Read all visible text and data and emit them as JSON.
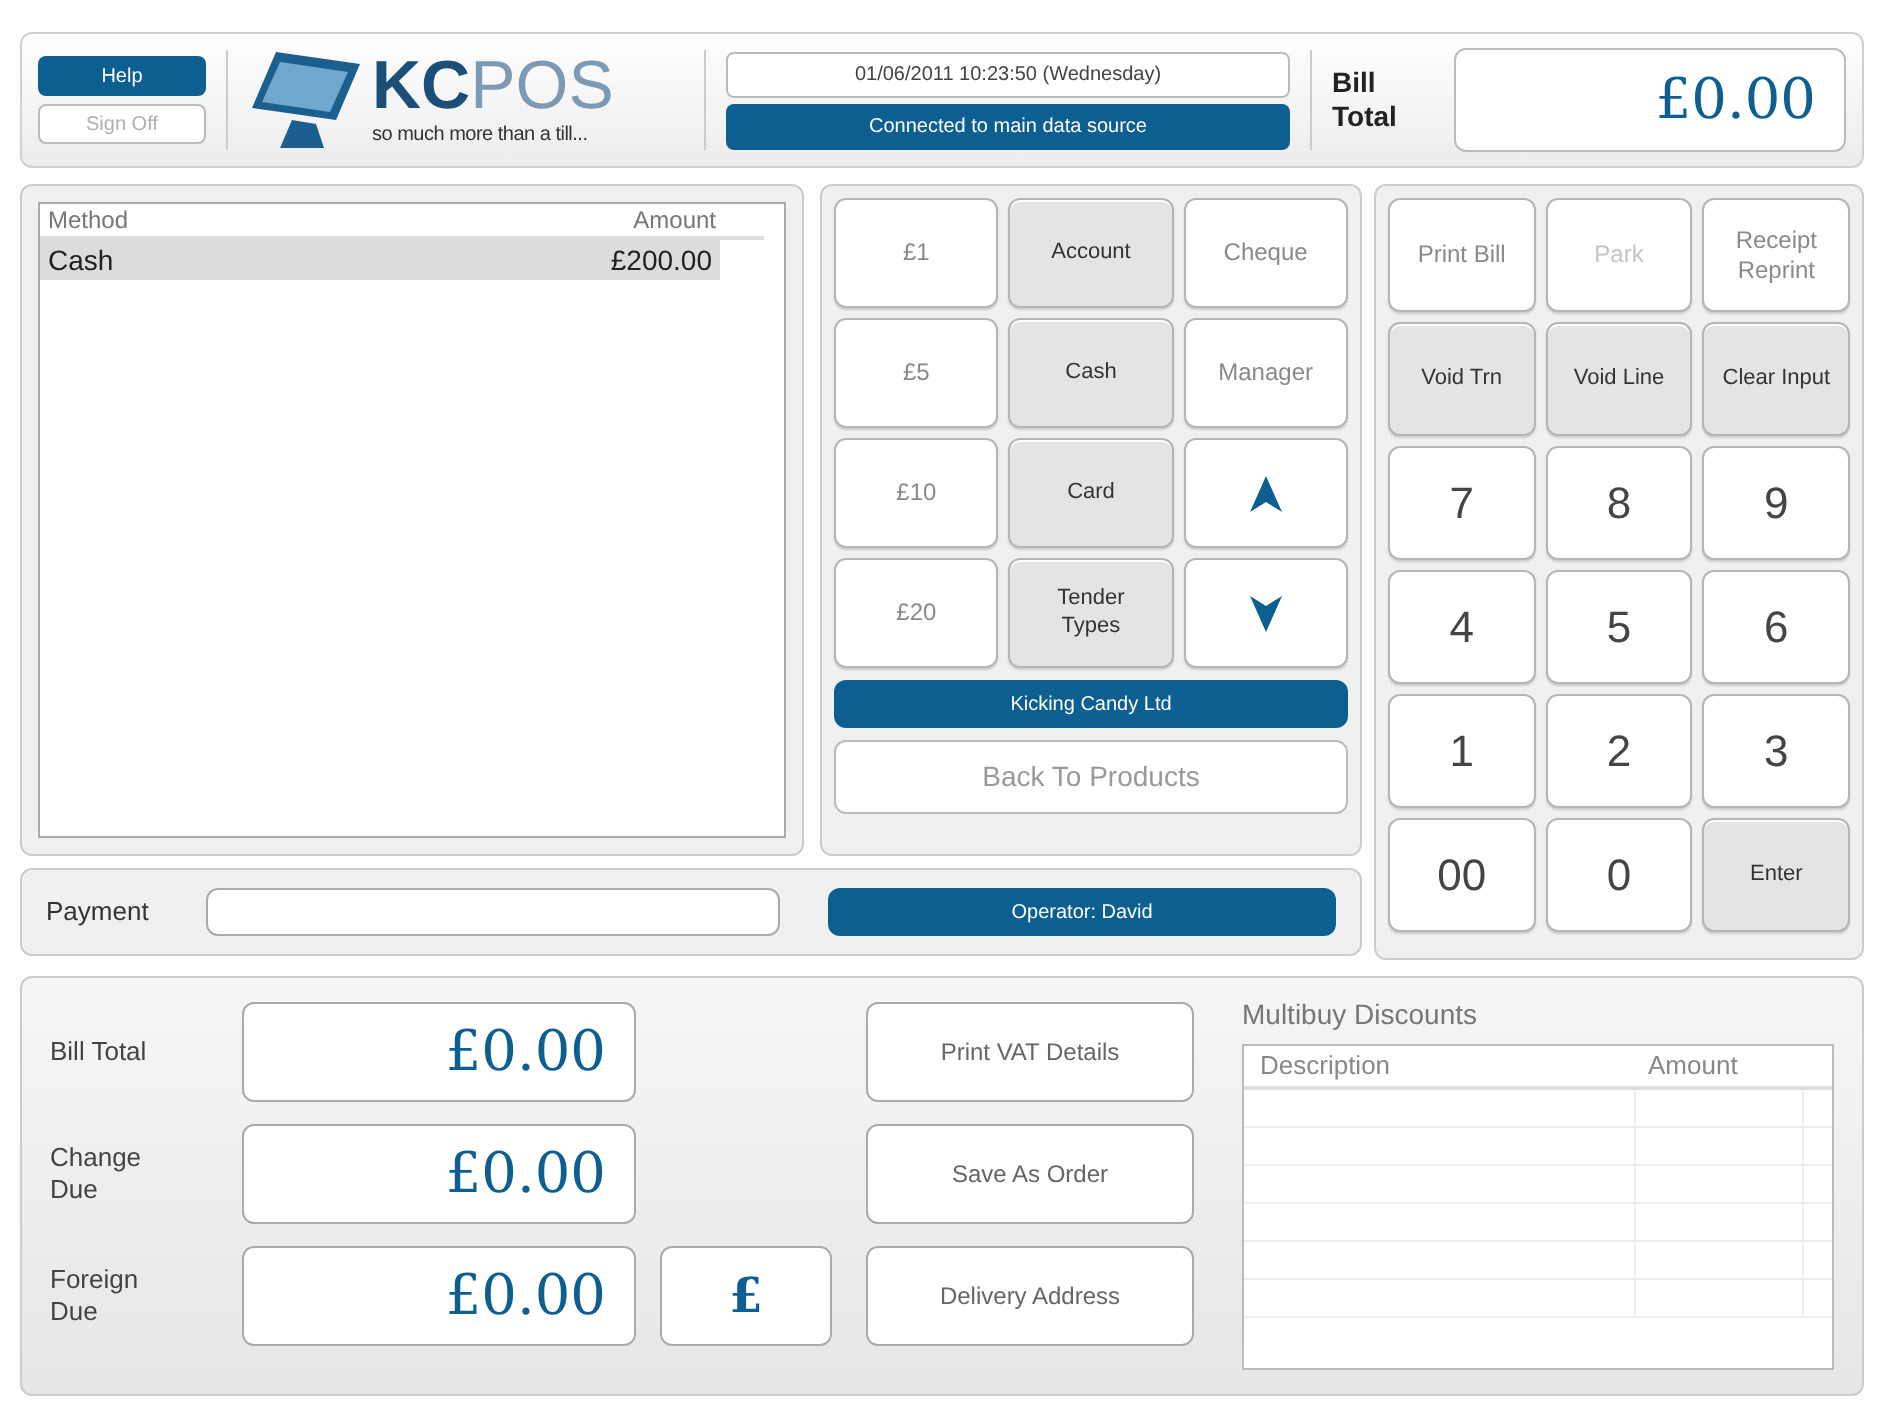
{
  "header": {
    "help": "Help",
    "sign_off": {
      "label": "Sign Off",
      "disabled": true
    },
    "logo": {
      "brand_bold": "KC",
      "brand_light": "POS",
      "tagline": "so much more than a till..."
    },
    "datetime": "01/06/2011 10:23:50  (Wednesday)",
    "connection": "Connected to main data source",
    "bill_total_label": "Bill Total",
    "bill_total": "£0.00"
  },
  "payments_table": {
    "columns": [
      "Method",
      "Amount"
    ],
    "rows": [
      {
        "method": "Cash",
        "amount": "£200.00",
        "selected": true
      }
    ]
  },
  "tender_buttons": [
    {
      "label": "£1",
      "kind": "plain"
    },
    {
      "label": "Account",
      "kind": "shaded"
    },
    {
      "label": "Cheque",
      "kind": "plain"
    },
    {
      "label": "£5",
      "kind": "plain"
    },
    {
      "label": "Cash",
      "kind": "shaded"
    },
    {
      "label": "Manager",
      "kind": "plain"
    },
    {
      "label": "£10",
      "kind": "plain"
    },
    {
      "label": "Card",
      "kind": "shaded"
    },
    {
      "kind": "up"
    },
    {
      "label": "£20",
      "kind": "plain"
    },
    {
      "label": "Tender Types",
      "kind": "shaded"
    },
    {
      "kind": "down"
    }
  ],
  "company": "Kicking Candy Ltd",
  "back_button": "Back To Products",
  "keypad_rows": [
    {
      "keys": [
        {
          "label": "Print Bill",
          "kind": "plain"
        },
        {
          "label": "Park",
          "kind": "faint"
        },
        {
          "label": "Receipt Reprint",
          "kind": "plain"
        }
      ]
    },
    {
      "keys": [
        {
          "label": "Void Trn",
          "kind": "shaded"
        },
        {
          "label": "Void Line",
          "kind": "shaded"
        },
        {
          "label": "Clear Input",
          "kind": "shaded"
        }
      ]
    },
    {
      "keys": [
        {
          "label": "7",
          "kind": "digit"
        },
        {
          "label": "8",
          "kind": "digit"
        },
        {
          "label": "9",
          "kind": "digit"
        }
      ]
    },
    {
      "keys": [
        {
          "label": "4",
          "kind": "digit"
        },
        {
          "label": "5",
          "kind": "digit"
        },
        {
          "label": "6",
          "kind": "digit"
        }
      ]
    },
    {
      "keys": [
        {
          "label": "1",
          "kind": "digit"
        },
        {
          "label": "2",
          "kind": "digit"
        },
        {
          "label": "3",
          "kind": "digit"
        }
      ]
    },
    {
      "keys": [
        {
          "label": "00",
          "kind": "digit"
        },
        {
          "label": "0",
          "kind": "digit"
        },
        {
          "label": "Enter",
          "kind": "shaded"
        }
      ]
    }
  ],
  "payment": {
    "label": "Payment"
  },
  "operator": "Operator: David",
  "totals": [
    {
      "label": "Bill Total",
      "value": "£0.00"
    },
    {
      "label": "Change Due",
      "value": "£0.00"
    },
    {
      "label": "Foreign Due",
      "value": "£0.00",
      "currency": "£"
    }
  ],
  "actions": [
    "Print VAT Details",
    "Save As Order",
    "Delivery Address"
  ],
  "multibuy": {
    "title": "Multibuy Discounts",
    "columns": [
      "Description",
      "Amount"
    ]
  }
}
